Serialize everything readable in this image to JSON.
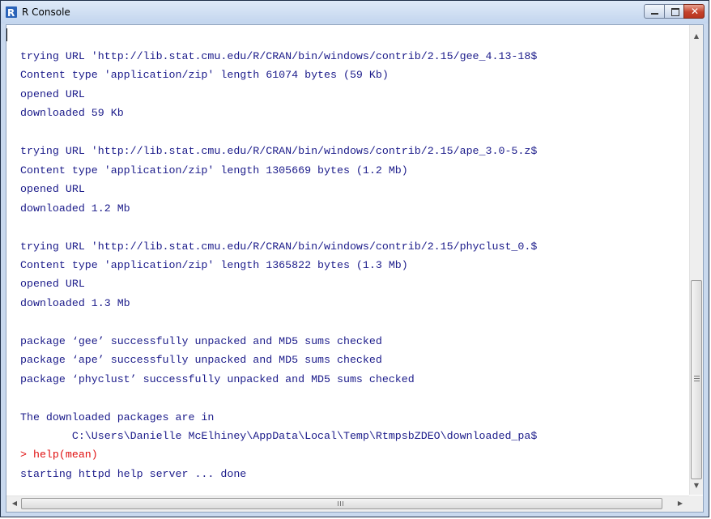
{
  "window": {
    "title": "R Console",
    "app_icon": "r-logo-icon",
    "controls": {
      "minimize": "minimize-icon",
      "maximize": "maximize-icon",
      "close": "close-icon",
      "close_glyph": "✕"
    }
  },
  "console": {
    "lines": [
      {
        "text": "trying URL 'http://lib.stat.cmu.edu/R/CRAN/bin/windows/contrib/2.15/gee_4.13-18$",
        "color": "output"
      },
      {
        "text": "Content type 'application/zip' length 61074 bytes (59 Kb)",
        "color": "output"
      },
      {
        "text": "opened URL",
        "color": "output"
      },
      {
        "text": "downloaded 59 Kb",
        "color": "output"
      },
      {
        "text": "",
        "color": "output"
      },
      {
        "text": "trying URL 'http://lib.stat.cmu.edu/R/CRAN/bin/windows/contrib/2.15/ape_3.0-5.z$",
        "color": "output"
      },
      {
        "text": "Content type 'application/zip' length 1305669 bytes (1.2 Mb)",
        "color": "output"
      },
      {
        "text": "opened URL",
        "color": "output"
      },
      {
        "text": "downloaded 1.2 Mb",
        "color": "output"
      },
      {
        "text": "",
        "color": "output"
      },
      {
        "text": "trying URL 'http://lib.stat.cmu.edu/R/CRAN/bin/windows/contrib/2.15/phyclust_0.$",
        "color": "output"
      },
      {
        "text": "Content type 'application/zip' length 1365822 bytes (1.3 Mb)",
        "color": "output"
      },
      {
        "text": "opened URL",
        "color": "output"
      },
      {
        "text": "downloaded 1.3 Mb",
        "color": "output"
      },
      {
        "text": "",
        "color": "output"
      },
      {
        "text": "package ‘gee’ successfully unpacked and MD5 sums checked",
        "color": "output"
      },
      {
        "text": "package ‘ape’ successfully unpacked and MD5 sums checked",
        "color": "output"
      },
      {
        "text": "package ‘phyclust’ successfully unpacked and MD5 sums checked",
        "color": "output"
      },
      {
        "text": "",
        "color": "output"
      },
      {
        "text": "The downloaded packages are in",
        "color": "output"
      },
      {
        "text": "        C:\\Users\\Danielle McElhiney\\AppData\\Local\\Temp\\RtmpsbZDEO\\downloaded_pa$",
        "color": "output"
      },
      {
        "text": "> help(mean)",
        "color": "input"
      },
      {
        "text": "starting httpd help server ... done",
        "color": "output"
      }
    ],
    "prompt": ">",
    "output_color": "#1b1b8a",
    "input_color": "#e01010"
  },
  "scrollbars": {
    "up": "▲",
    "down": "▼",
    "left": "◀",
    "right": "▶"
  }
}
